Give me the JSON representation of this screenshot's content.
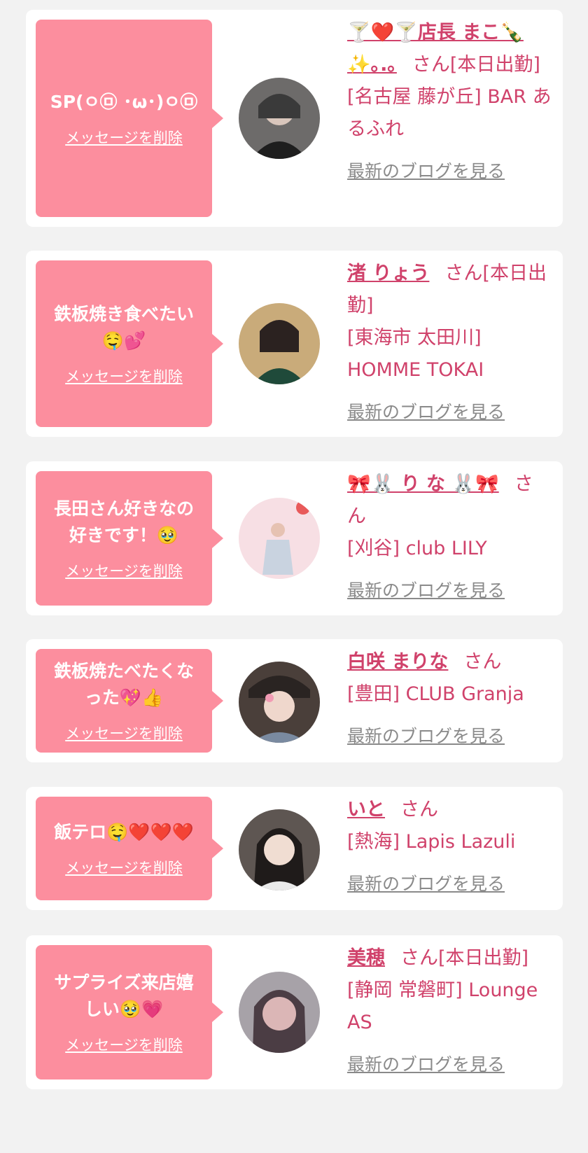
{
  "messages": [
    {
      "text": "SP(ㅇ㉤ ･ω･)ㅇ㉤",
      "delete_label": "メッセージを削除",
      "name": "🍸❤️🍸店長 まこ🍾✨｡.｡",
      "san_label": "さん[本日出勤]",
      "shop": "[名古屋 藤が丘] BAR あるふれ",
      "blog_label": "最新のブログを見る",
      "avatar_color": "#2e2e2e"
    },
    {
      "text": "鉄板焼き食べたい🤤💕",
      "delete_label": "メッセージを削除",
      "name": "渚 りょう",
      "san_label": "さん[本日出勤]",
      "shop": "[東海市 太田川] HOMME TOKAI",
      "blog_label": "最新のブログを見る",
      "avatar_color": "#b89a6a"
    },
    {
      "text": "長田さん好きなの好きです！🥹",
      "delete_label": "メッセージを削除",
      "name": "🎀🐰 り な 🐰🎀",
      "san_label": "さん",
      "shop": "[刈谷] club LILY",
      "blog_label": "最新のブログを見る",
      "avatar_color": "#f3c6d0"
    },
    {
      "text": "鉄板焼たべたくなった💖👍",
      "delete_label": "メッセージを削除",
      "name": "白咲 まりな",
      "san_label": "さん",
      "shop": "[豊田] CLUB Granja",
      "blog_label": "最新のブログを見る",
      "avatar_color": "#5a4a44"
    },
    {
      "text": "飯テロ🤤❤️❤️❤️",
      "delete_label": "メッセージを削除",
      "name": "いと",
      "san_label": "さん",
      "shop": "[熱海] Lapis Lazuli",
      "blog_label": "最新のブログを見る",
      "avatar_color": "#3b3534"
    },
    {
      "text": "サプライズ来店嬉しい🥹💗",
      "delete_label": "メッセージを削除",
      "name": "美穂",
      "san_label": "さん[本日出勤]",
      "shop": "[静岡 常磐町] Lounge AS",
      "blog_label": "最新のブログを見る",
      "avatar_color": "#9a8a96"
    }
  ],
  "colors": {
    "accent": "#d0426b",
    "bubble": "#fc8e9e",
    "background": "#f2f2f2",
    "link_gray": "#8a8a8a"
  }
}
